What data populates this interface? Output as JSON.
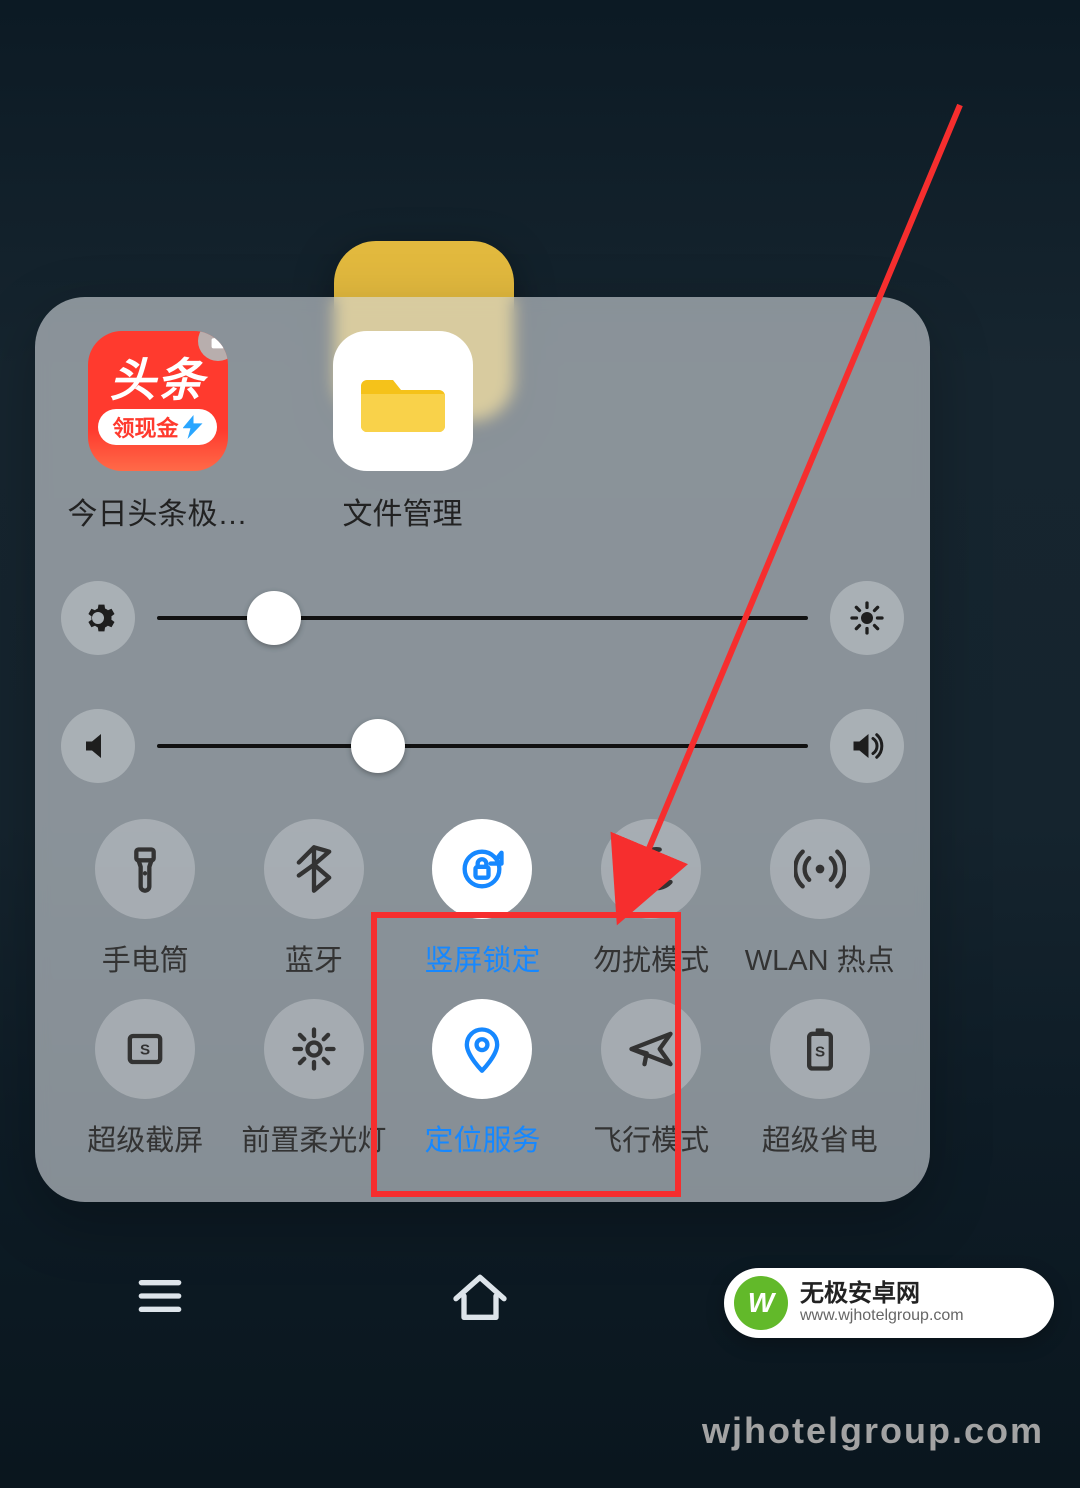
{
  "apps": [
    {
      "label": "今日头条极…",
      "icon": "toutiao",
      "badge_text": "头条",
      "bonus_text": "领现金",
      "locked": true
    },
    {
      "label": "文件管理",
      "icon": "folder"
    }
  ],
  "brightness": {
    "percent": 18
  },
  "volume": {
    "percent": 34
  },
  "toggles": [
    {
      "label": "手电筒",
      "active": false
    },
    {
      "label": "蓝牙",
      "active": false
    },
    {
      "label": "竖屏锁定",
      "active": true
    },
    {
      "label": "勿扰模式",
      "active": false
    },
    {
      "label": "WLAN 热点",
      "active": false
    },
    {
      "label": "超级截屏",
      "active": false
    },
    {
      "label": "前置柔光灯",
      "active": false
    },
    {
      "label": "定位服务",
      "active": true
    },
    {
      "label": "飞行模式",
      "active": false
    },
    {
      "label": "超级省电",
      "active": false
    }
  ],
  "annotation": {
    "highlight_index": 7,
    "arrow_target": "toggle-dnd"
  },
  "watermark": {
    "logo_text": "W",
    "title": "无极安卓网",
    "subtitle": "www.wjhotelgroup.com",
    "url": "wjhotelgroup.com"
  }
}
